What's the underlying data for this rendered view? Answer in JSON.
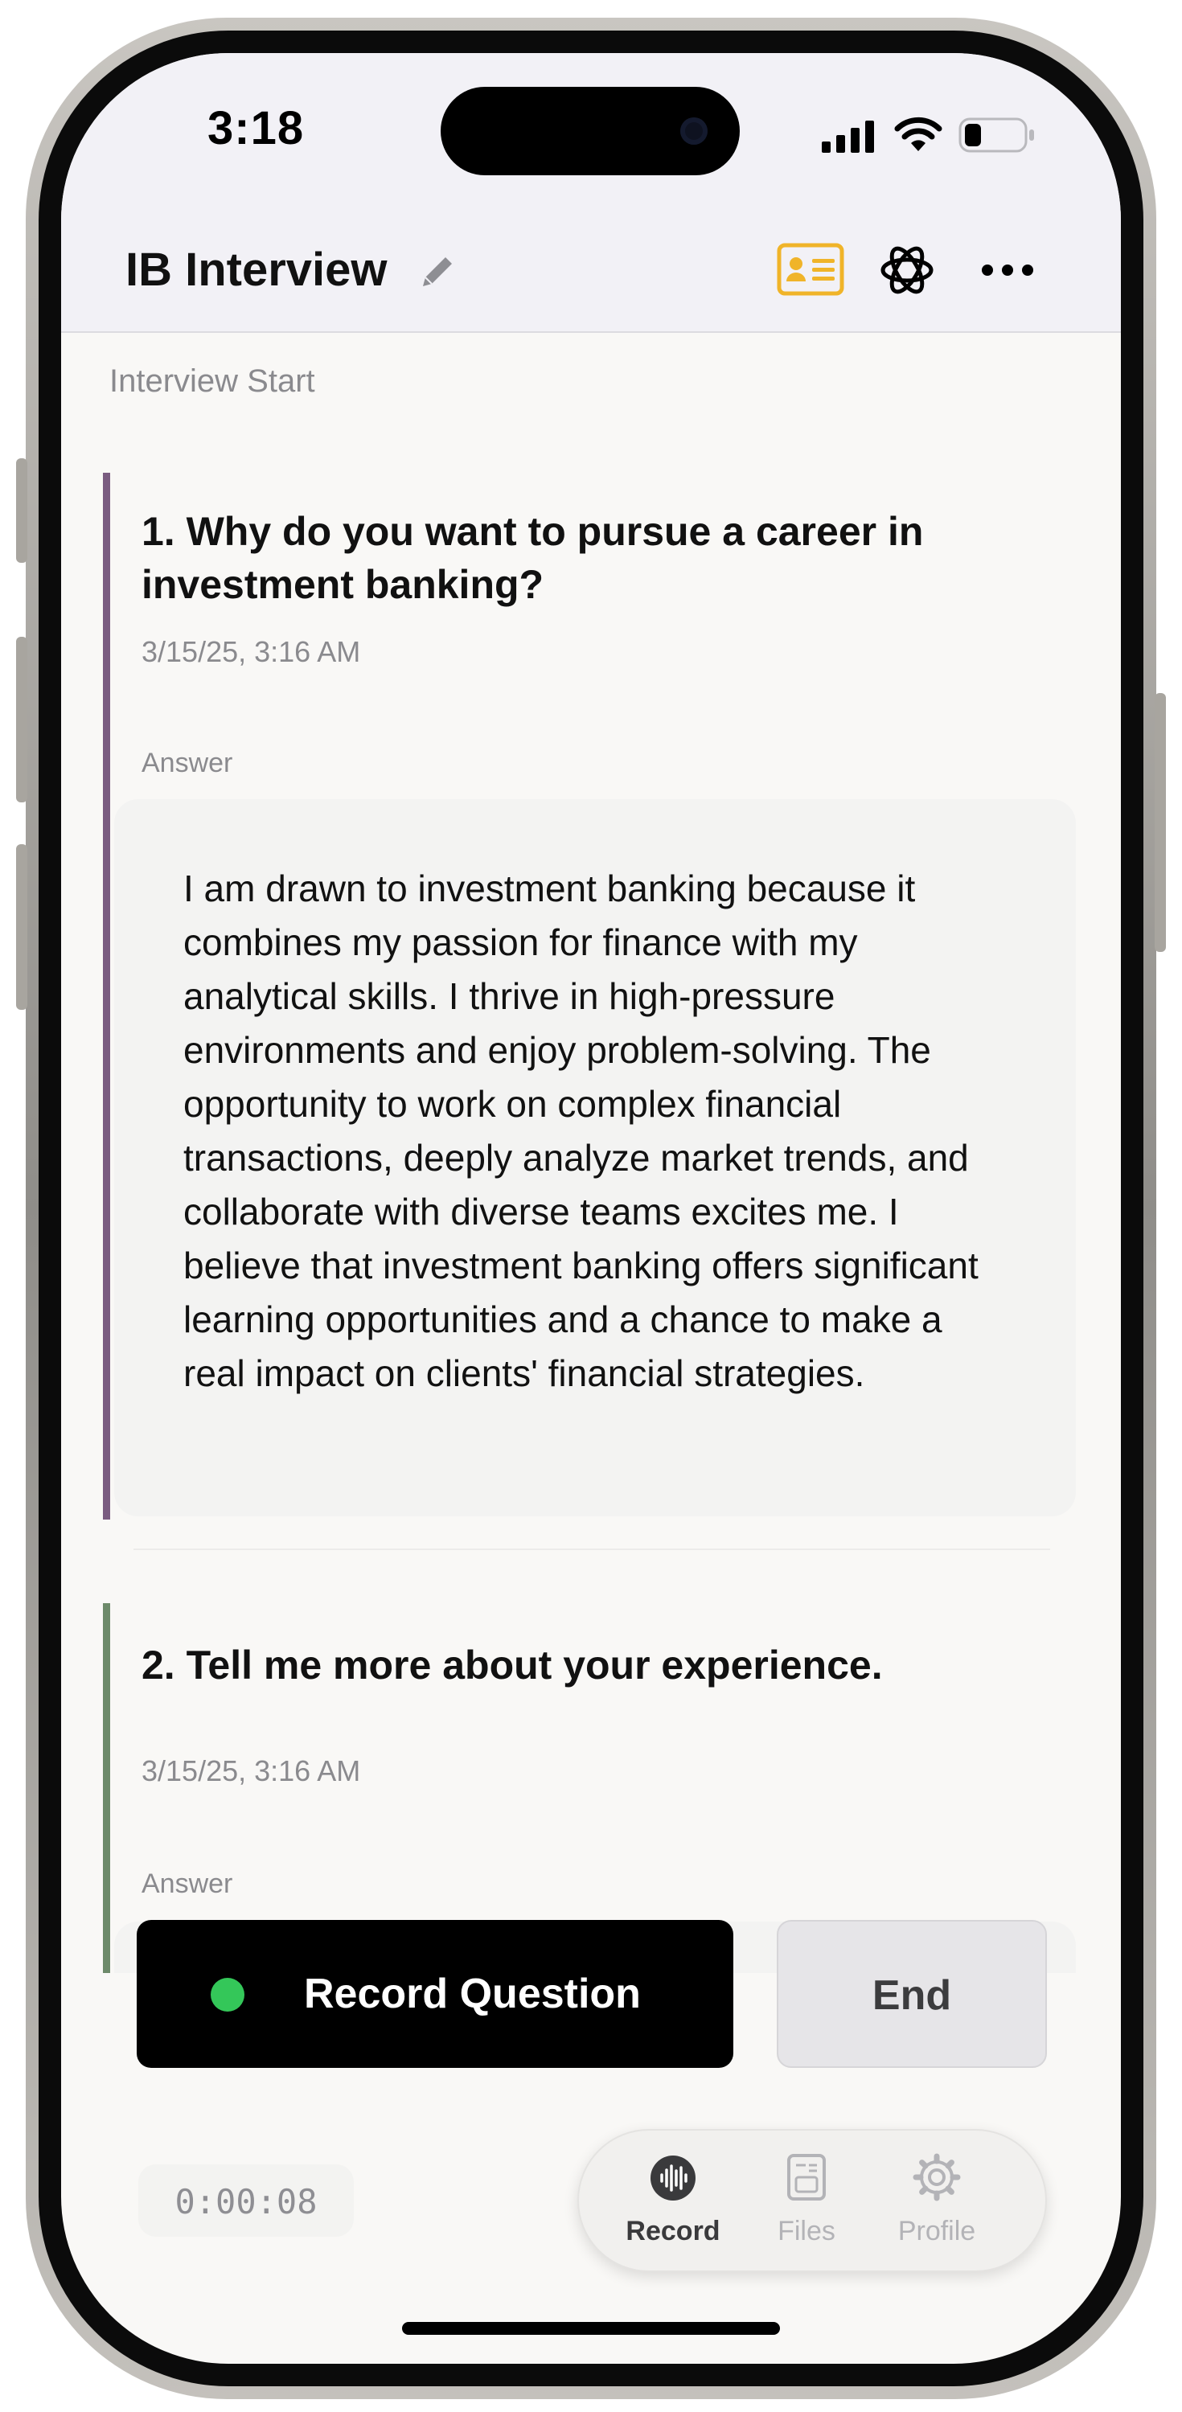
{
  "status_bar": {
    "time": "3:18"
  },
  "header": {
    "title": "IB Interview"
  },
  "session": {
    "start_label": "Interview Start"
  },
  "questions": [
    {
      "title": "1. Why do you want to pursue a career in investment banking?",
      "timestamp": "3/15/25, 3:16 AM",
      "answer_label": "Answer",
      "answer": "I am drawn to investment banking because it combines my passion for finance with my analytical skills. I thrive in high-pressure environments and enjoy problem-solving. The opportunity to work on complex financial transactions, deeply analyze market trends, and collaborate with diverse teams excites me. I believe that investment banking offers significant learning opportunities and a chance to make a real impact on clients' financial strategies.",
      "accent": "#7a5c80"
    },
    {
      "title": "2. Tell me more about your experience.",
      "timestamp": "3/15/25, 3:16 AM",
      "answer_label": "Answer",
      "accent": "#6d8a6a"
    }
  ],
  "actions": {
    "record_label": "Record Question",
    "end_label": "End"
  },
  "timer": "0:00:08",
  "tabs": [
    {
      "label": "Record",
      "icon": "waveform-icon",
      "active": true
    },
    {
      "label": "Files",
      "icon": "document-icon",
      "active": false
    },
    {
      "label": "Profile",
      "icon": "gear-icon",
      "active": false
    }
  ],
  "colors": {
    "record_dot": "#34c759",
    "contact_card": "#f0b429"
  }
}
